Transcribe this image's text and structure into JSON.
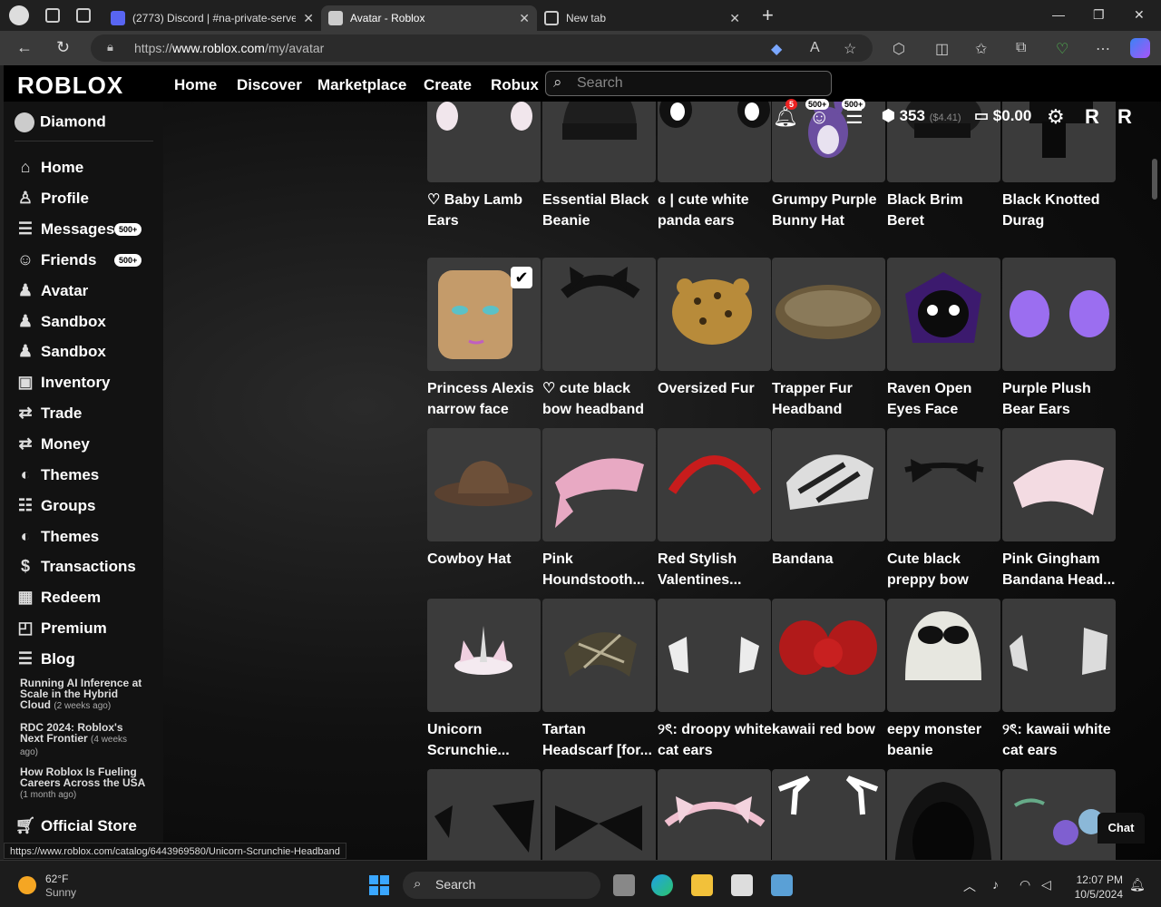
{
  "browser": {
    "tabs": [
      {
        "label": "(2773) Discord | #na-private-serve",
        "badge": "2k+"
      },
      {
        "label": "Avatar - Roblox"
      },
      {
        "label": "New tab"
      }
    ],
    "new_tab": "+",
    "url_prefix": "https://",
    "url_host": "www.roblox.com",
    "url_path": "/my/avatar",
    "status_url": "https://www.roblox.com/catalog/6443969580/Unicorn-Scrunchie-Headband"
  },
  "header": {
    "logo": "ROBLOX",
    "nav": [
      "Home",
      "Discover",
      "Marketplace",
      "Create",
      "Robux"
    ],
    "search_placeholder": "Search",
    "notifications": "5",
    "friends_badge": "500+",
    "messages_badge": "500+",
    "robux": "353",
    "robux_value": "($4.41)",
    "balance": "$0.00"
  },
  "sidebar": {
    "user": "Diamond",
    "items": [
      {
        "label": "Home",
        "icon": "home-icon",
        "glyph": "⌂"
      },
      {
        "label": "Profile",
        "icon": "profile-icon",
        "glyph": "♙"
      },
      {
        "label": "Messages",
        "icon": "messages-icon",
        "glyph": "☰",
        "count": "500+"
      },
      {
        "label": "Friends",
        "icon": "friends-icon",
        "glyph": "☺",
        "count": "500+"
      },
      {
        "label": "Avatar",
        "icon": "avatar-icon",
        "glyph": "♟"
      },
      {
        "label": "Sandbox",
        "icon": "sandbox-icon",
        "glyph": "♟"
      },
      {
        "label": "Sandbox",
        "icon": "sandbox-icon",
        "glyph": "♟"
      },
      {
        "label": "Inventory",
        "icon": "inventory-icon",
        "glyph": "▣"
      },
      {
        "label": "Trade",
        "icon": "trade-icon",
        "glyph": "⇄"
      },
      {
        "label": "Money",
        "icon": "money-icon",
        "glyph": "⇄"
      },
      {
        "label": "Themes",
        "icon": "themes-icon",
        "glyph": "◐"
      },
      {
        "label": "Groups",
        "icon": "groups-icon",
        "glyph": "☷"
      },
      {
        "label": "Themes",
        "icon": "themes-icon",
        "glyph": "◐"
      },
      {
        "label": "Transactions",
        "icon": "transactions-icon",
        "glyph": "$"
      },
      {
        "label": "Redeem",
        "icon": "redeem-icon",
        "glyph": "▦"
      },
      {
        "label": "Premium",
        "icon": "premium-icon",
        "glyph": "◰"
      },
      {
        "label": "Blog",
        "icon": "blog-icon",
        "glyph": "☰"
      }
    ],
    "blog_posts": [
      {
        "title": "Running AI Inference at Scale in the Hybrid Cloud",
        "age": "(2 weeks ago)"
      },
      {
        "title": "RDC 2024: Roblox's Next Frontier",
        "age": "(4 weeks ago)"
      },
      {
        "title": "How Roblox Is Fueling Careers Across the USA",
        "age": "(1 month ago)"
      }
    ],
    "store": "Official Store"
  },
  "items": [
    {
      "name": "♡ Baby Lamb Ears",
      "art": "lamb"
    },
    {
      "name": "Essential Black Beanie",
      "art": "beanie"
    },
    {
      "name": "ɞ | cute white panda ears",
      "art": "panda"
    },
    {
      "name": "Grumpy Purple Bunny Hat",
      "art": "bunny"
    },
    {
      "name": "Black Brim Beret",
      "art": "beret"
    },
    {
      "name": "Black Knotted Durag",
      "art": "durag"
    },
    {
      "name": "Princess Alexis narrow face",
      "art": "face",
      "checked": true
    },
    {
      "name": "♡ cute black bow headband",
      "art": "blackbow"
    },
    {
      "name": "Oversized Fur",
      "art": "leopard"
    },
    {
      "name": "Trapper Fur Headband",
      "art": "fur"
    },
    {
      "name": "Raven Open Eyes Face",
      "art": "raven"
    },
    {
      "name": "Purple Plush Bear Ears",
      "art": "purpleears"
    },
    {
      "name": "Cowboy Hat",
      "art": "cowboy"
    },
    {
      "name": "Pink Houndstooth...",
      "art": "pinkscarf"
    },
    {
      "name": "Red Stylish Valentines...",
      "art": "redband"
    },
    {
      "name": "Bandana",
      "art": "bandana"
    },
    {
      "name": "Cute black preppy bow",
      "art": "preppybow"
    },
    {
      "name": "Pink Gingham Bandana Head...",
      "art": "gingham"
    },
    {
      "name": "Unicorn Scrunchie...",
      "art": "unicorn"
    },
    {
      "name": "Tartan Headscarf [for...",
      "art": "tartan"
    },
    {
      "name": "୨ৎ: droopy white cat ears",
      "art": "whiteears"
    },
    {
      "name": "kawaii red bow",
      "art": "redbow"
    },
    {
      "name": "eepy monster beanie",
      "art": "monster"
    },
    {
      "name": "୨ৎ: kawaii white cat ears",
      "art": "catears"
    },
    {
      "name": "",
      "art": "blackears"
    },
    {
      "name": "",
      "art": "bigbow"
    },
    {
      "name": "",
      "art": "pinkbow"
    },
    {
      "name": "",
      "art": "outline"
    },
    {
      "name": "",
      "art": "hood"
    },
    {
      "name": "",
      "art": "flowers"
    }
  ],
  "chat_label": "Chat",
  "taskbar": {
    "temp": "62°F",
    "condition": "Sunny",
    "search": "Search",
    "time": "12:07 PM",
    "date": "10/5/2024"
  }
}
